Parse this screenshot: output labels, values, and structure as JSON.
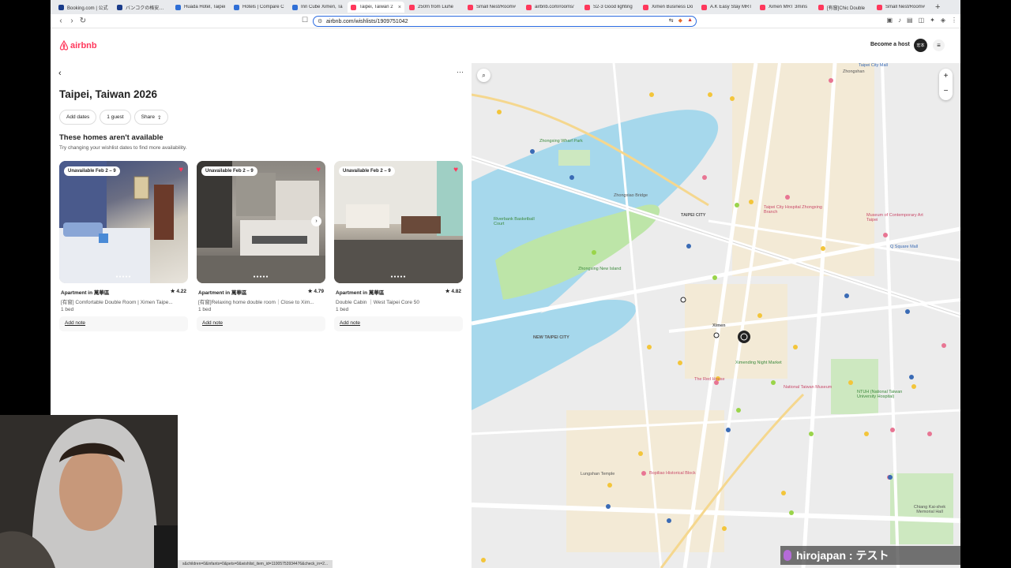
{
  "browser": {
    "tabs": [
      {
        "label": "Booking.com | 公式",
        "color": "#1a3c8a",
        "active": false
      },
      {
        "label": "バンコクの格安ホテル",
        "color": "#1a3c8a",
        "active": false
      },
      {
        "label": "Huada Hotel, Taipei",
        "color": "#2f6fd6",
        "active": false
      },
      {
        "label": "Hotels | Compare C",
        "color": "#2f6fd6",
        "active": false
      },
      {
        "label": "Inn Cube Ximen, Ta",
        "color": "#2f6fd6",
        "active": false
      },
      {
        "label": "Taipei, Taiwan 2",
        "color": "#ff385c",
        "active": true
      },
      {
        "label": "250m from Liuhe",
        "color": "#ff385c",
        "active": false
      },
      {
        "label": "Small Nest/Room#",
        "color": "#ff385c",
        "active": false
      },
      {
        "label": "airbnb.com/rooms/",
        "color": "#ff385c",
        "active": false
      },
      {
        "label": "S2-3 Good lighting",
        "color": "#ff385c",
        "active": false
      },
      {
        "label": "Ximen Business Do",
        "color": "#ff385c",
        "active": false
      },
      {
        "label": "A.K Easy Stay MRT",
        "color": "#ff385c",
        "active": false
      },
      {
        "label": "Ximen MRT 3mins",
        "color": "#ff385c",
        "active": false
      },
      {
        "label": "[有窗]Chic Double",
        "color": "#ff385c",
        "active": false
      },
      {
        "label": "Small Nest/Room#",
        "color": "#ff385c",
        "active": false
      }
    ],
    "url": "airbnb.com/wishlists/1909751042",
    "status_url": "s&children=0&infants=0&pets=0&wishlist_item_id=11005753934476&check_in=2..."
  },
  "header": {
    "logo_text": "airbnb",
    "become_host": "Become a host",
    "avatar_text": "宏本"
  },
  "wishlist": {
    "title": "Taipei, Taiwan 2026",
    "chips": [
      "Add dates",
      "1 guest",
      "Share"
    ],
    "section_title": "These homes aren't available",
    "section_sub": "Try changing your wishlist dates to find more availability.",
    "cards": [
      {
        "badge": "Unavailable Feb 2 – 9",
        "type": "Apartment in 萬華區",
        "rating": "★ 4.22",
        "name": "[有窗] Comfortable Double Room | Ximen Taipe...",
        "beds": "1 bed",
        "note": "Add note"
      },
      {
        "badge": "Unavailable Feb 2 – 9",
        "type": "Apartment in 萬華區",
        "rating": "★ 4.79",
        "name": "[有窗]Relaxing home double room｜Close to Xim...",
        "beds": "1 bed",
        "note": "Add note"
      },
      {
        "badge": "Unavailable Feb 2 – 9",
        "type": "Apartment in 萬華區",
        "rating": "★ 4.82",
        "name": "Double Cabin ｜West Taipei Core 50",
        "beds": "1 bed",
        "note": "Add note"
      }
    ]
  },
  "map": {
    "labels": [
      {
        "t": "Zhongxing Wharf Park",
        "c": "g"
      },
      {
        "t": "Zhongxiao Bridge",
        "c": "d"
      },
      {
        "t": "Riverbank Basketball Court",
        "c": "g"
      },
      {
        "t": "Zhongxing New Island",
        "c": "g"
      },
      {
        "t": "Taipei City Hospital Zhongxing Branch",
        "c": "r"
      },
      {
        "t": "Museum of Contemporary Art Taipei",
        "c": "r"
      },
      {
        "t": "Ximending Night Market",
        "c": "g"
      },
      {
        "t": "National Taiwan Museum",
        "c": "r"
      },
      {
        "t": "NTUH (National Taiwan University Hospital)",
        "c": "g"
      },
      {
        "t": "Lungshan Temple",
        "c": "d"
      },
      {
        "t": "Bopiliao Historical Block",
        "c": "r"
      },
      {
        "t": "Chiang Kai-shek Memorial Hall",
        "c": "d"
      },
      {
        "t": "NEW TAIPEI CITY",
        "c": "d"
      },
      {
        "t": "TAIPEI CITY",
        "c": "d"
      },
      {
        "t": "Q Square Mall",
        "c": "b"
      },
      {
        "t": "Taipei City Mall",
        "c": "b"
      },
      {
        "t": "The Red House",
        "c": "r"
      },
      {
        "t": "Zhongshan",
        "c": "d"
      },
      {
        "t": "Ximen",
        "c": "d"
      }
    ]
  },
  "stream": {
    "handle": "hirojapan : テスト"
  }
}
